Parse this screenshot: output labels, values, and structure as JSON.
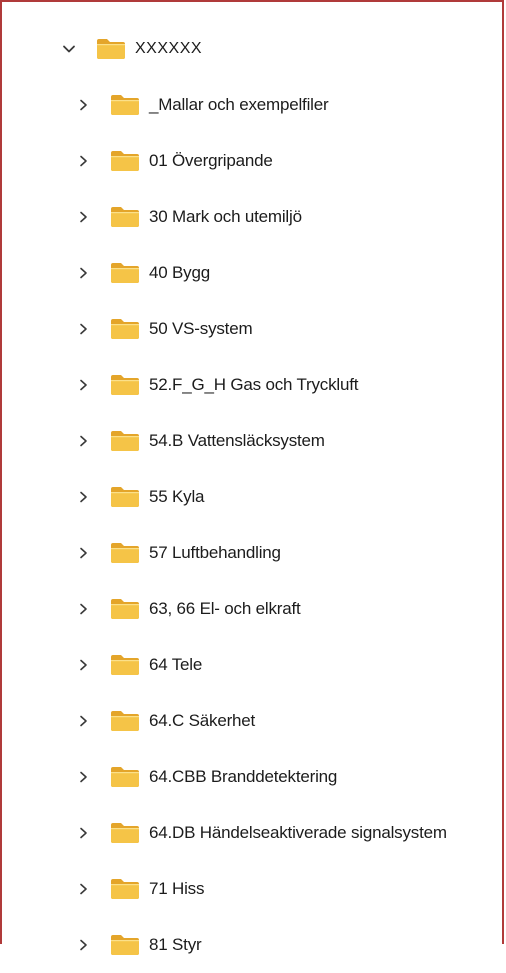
{
  "colors": {
    "folder_body": "#f0b93a",
    "folder_tab": "#e4a52a",
    "folder_front": "#f7cc55",
    "chevron": "#3a3a3a",
    "frame_border": "#b03a3a"
  },
  "tree": {
    "root": {
      "label": "XXXXXX",
      "expanded": true,
      "chevron_icon": "chevron-down-icon",
      "folder_icon": "folder-icon"
    },
    "children": [
      {
        "label": "_Mallar och exempelfiler"
      },
      {
        "label": "01 Övergripande"
      },
      {
        "label": "30 Mark och utemiljö"
      },
      {
        "label": "40 Bygg"
      },
      {
        "label": "50 VS-system"
      },
      {
        "label": "52.F_G_H Gas och Tryckluft"
      },
      {
        "label": "54.B Vattensläcksystem"
      },
      {
        "label": "55 Kyla"
      },
      {
        "label": "57 Luftbehandling"
      },
      {
        "label": "63, 66 El- och elkraft"
      },
      {
        "label": "64 Tele"
      },
      {
        "label": "64.C Säkerhet"
      },
      {
        "label": "64.CBB Branddetektering"
      },
      {
        "label": "64.DB Händelseaktiverade signalsystem"
      },
      {
        "label": "71 Hiss"
      },
      {
        "label": "81 Styr"
      }
    ]
  }
}
